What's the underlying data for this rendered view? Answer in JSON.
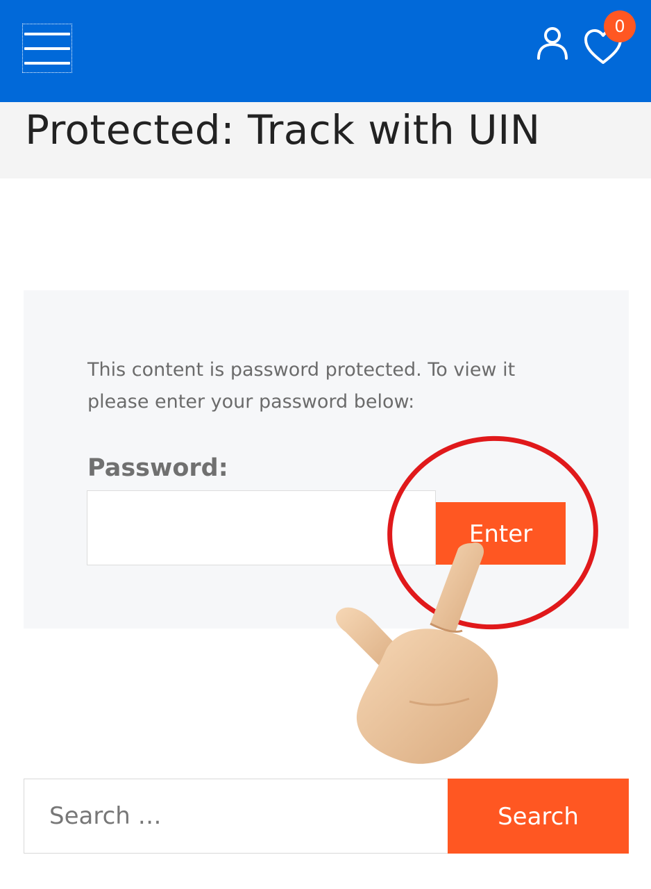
{
  "header": {
    "menu_icon": "hamburger-icon",
    "account_icon": "user-icon",
    "wishlist_icon": "heart-icon",
    "wishlist_count": "0",
    "brand_color": "#0169d9",
    "accent_color": "#ff5722"
  },
  "page": {
    "title": "Protected: Track with UIN"
  },
  "password_form": {
    "message": "This content is password protected. To view it please enter your password below:",
    "label": "Password:",
    "input_value": "",
    "submit_label": "Enter"
  },
  "search": {
    "placeholder": "Search …",
    "button_label": "Search"
  },
  "overlay": {
    "highlight": "red-circle",
    "pointer": "pointing-hand"
  }
}
